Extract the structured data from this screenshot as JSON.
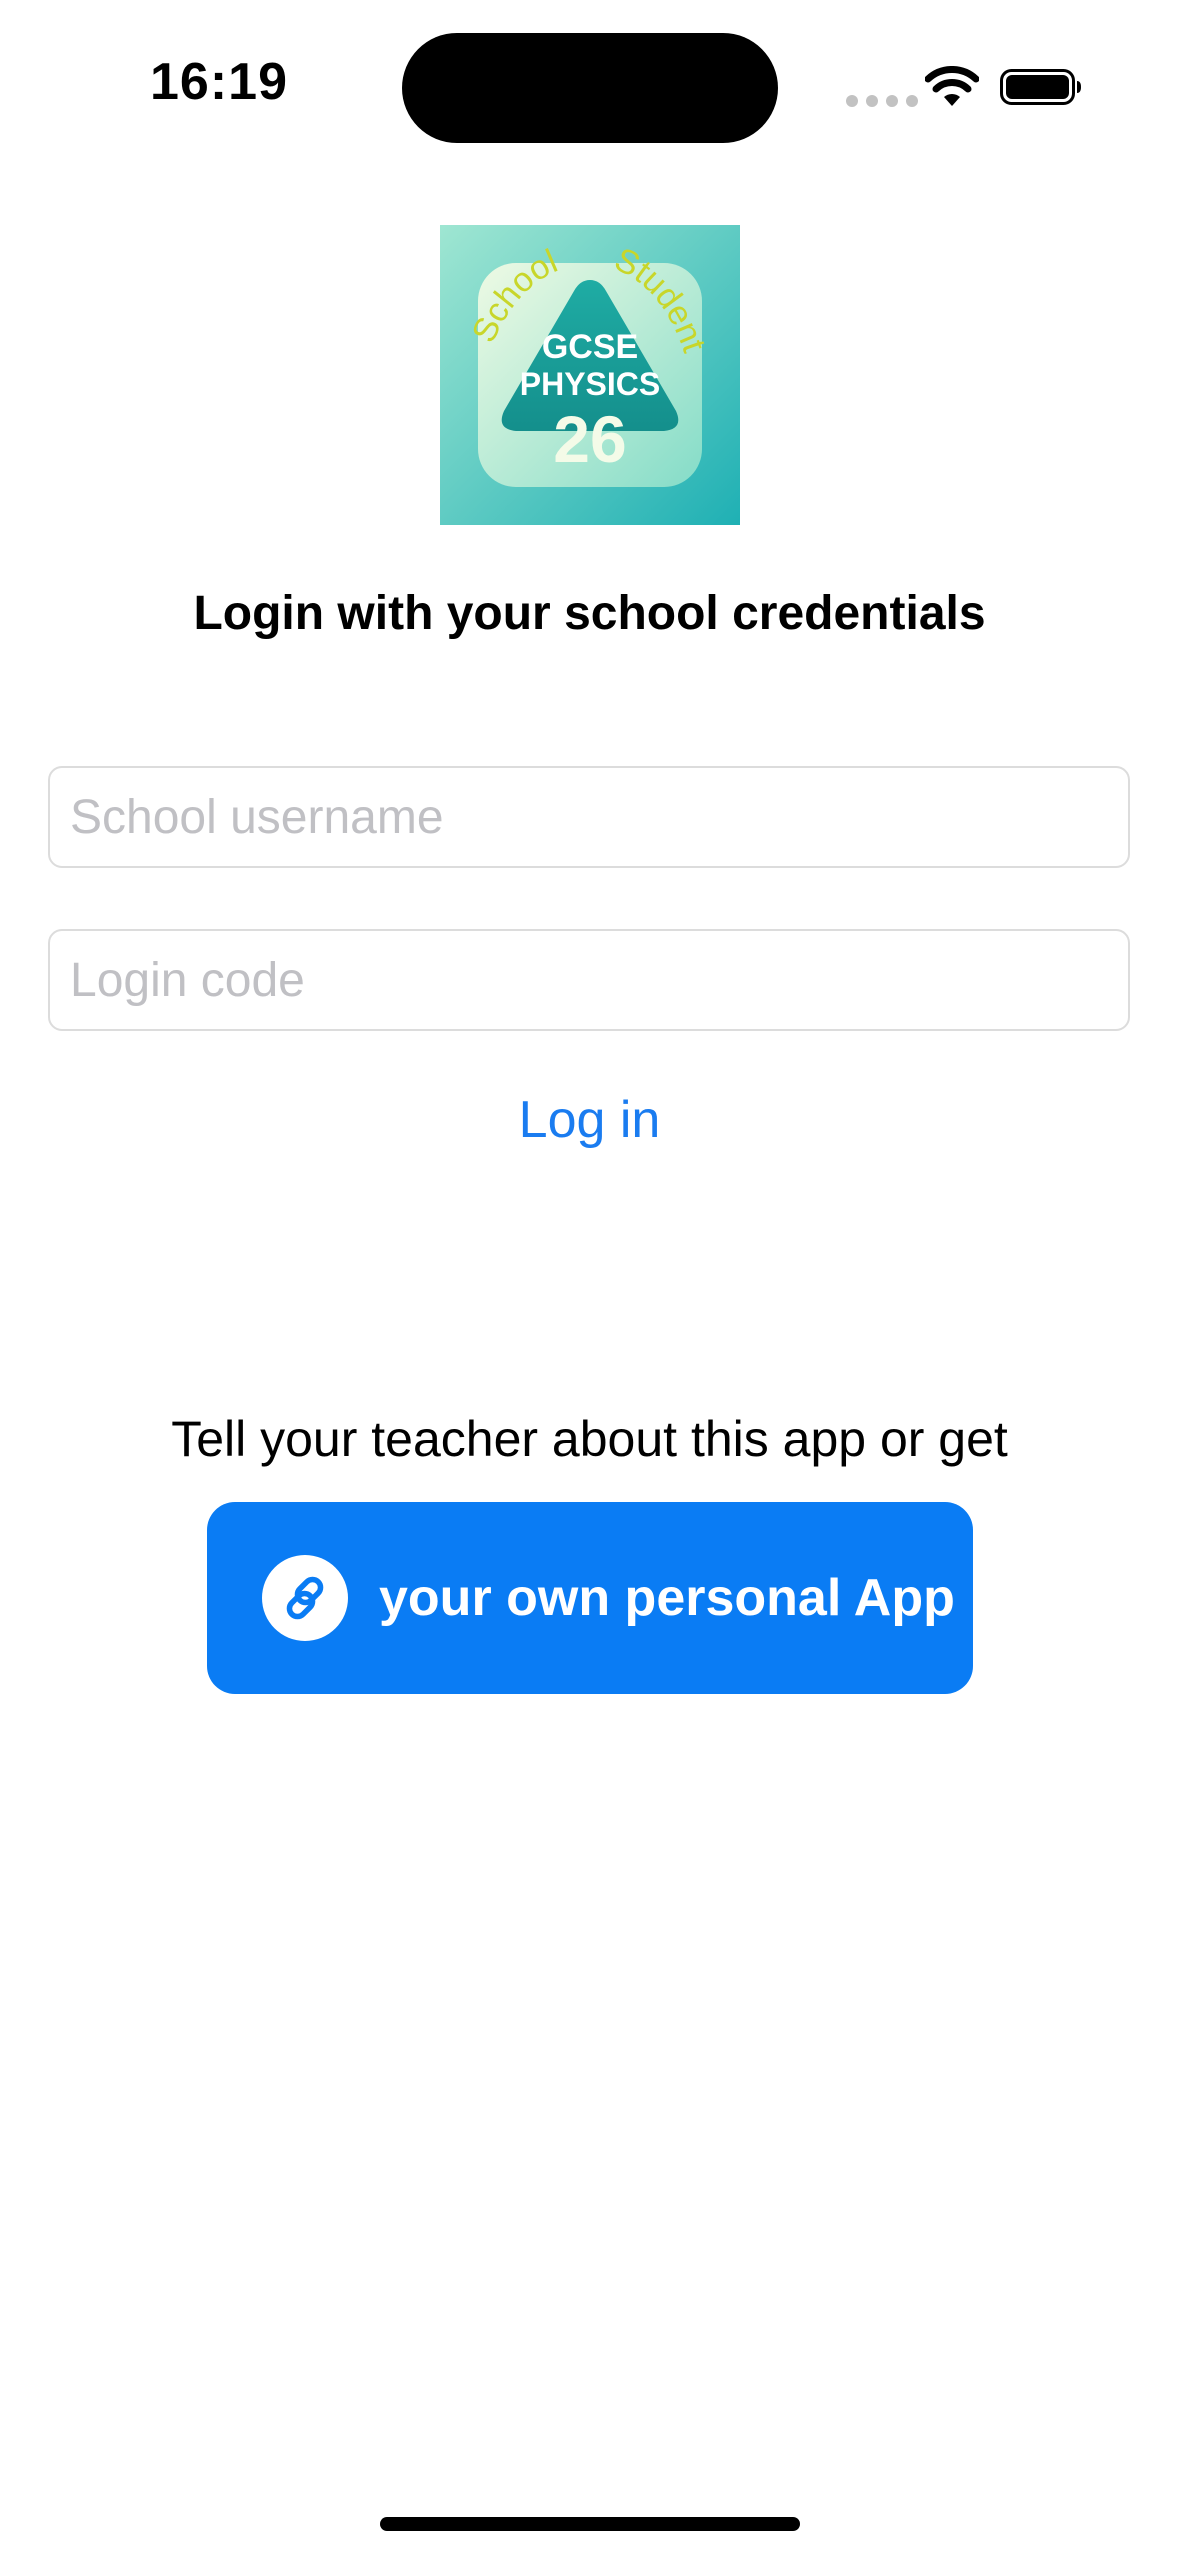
{
  "status_bar": {
    "time": "16:19"
  },
  "logo": {
    "curved_text_left": "School",
    "curved_text_right": "Student",
    "line1": "GCSE",
    "line2": "PHYSICS",
    "number": "26"
  },
  "login": {
    "title": "Login with your school credentials",
    "username_placeholder": "School username",
    "code_placeholder": "Login code",
    "login_label": "Log in"
  },
  "promo": {
    "text": "Tell your teacher about this app or get",
    "button_label": "your own personal App",
    "button_icon": "link-icon"
  },
  "colors": {
    "accent": "#0a7cf4",
    "link": "#1a7cf0",
    "logo_teal": "#20b1b0"
  }
}
